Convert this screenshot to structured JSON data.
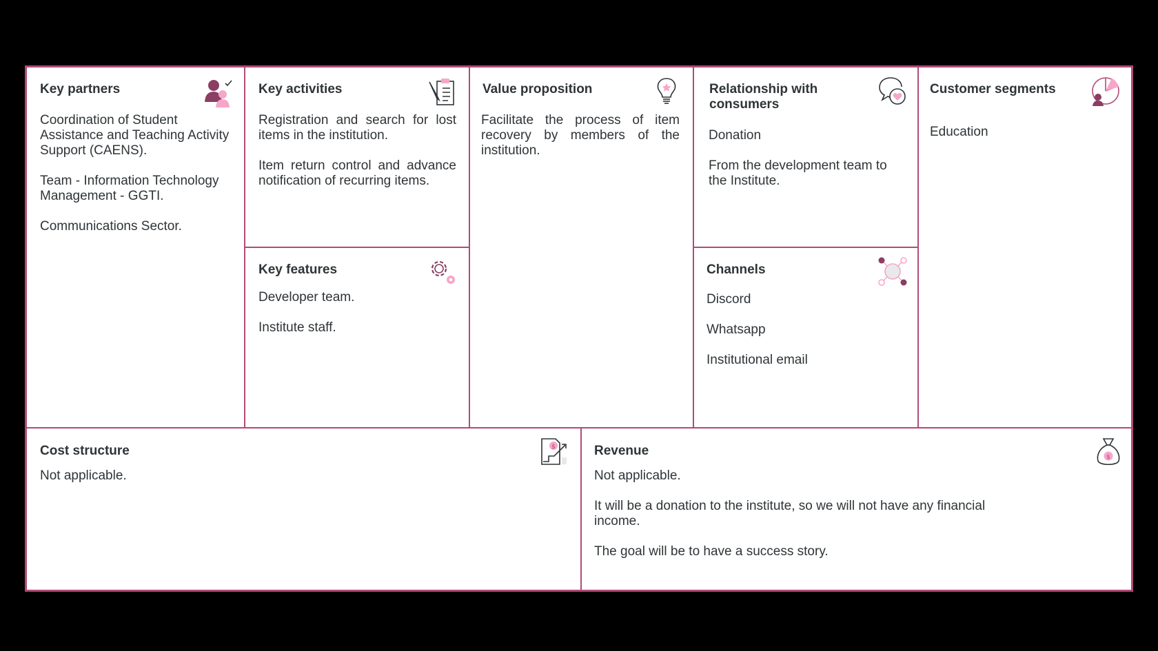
{
  "canvas": {
    "key_partners": {
      "title": "Key partners",
      "items": [
        "Coordination of Student Assistance and Teaching Activity Support (CAENS).",
        "Team - Information Technology Management - GGTI.",
        "Communications Sector."
      ],
      "icon": "partners-icon"
    },
    "key_activities": {
      "title": "Key activities",
      "items": [
        "Registration and search for lost items in the institution.",
        "Item return control and advance notification of recurring items."
      ],
      "icon": "clipboard-icon"
    },
    "key_features": {
      "title": "Key features",
      "items": [
        "Developer team.",
        "Institute staff."
      ],
      "icon": "gears-icon"
    },
    "value_proposition": {
      "title": "Value proposition",
      "items": [
        "Facilitate the process of item recovery by members of the institution."
      ],
      "icon": "lightbulb-icon"
    },
    "relationship": {
      "title": "Relationship with consumers",
      "items": [
        "Donation",
        "From the development team to the Institute."
      ],
      "icon": "chat-heart-icon"
    },
    "channels": {
      "title": "Channels",
      "items": [
        "Discord",
        "Whatsapp",
        "Institutional email"
      ],
      "icon": "network-icon"
    },
    "customer_segments": {
      "title": "Customer segments",
      "items": [
        "Education"
      ],
      "icon": "pie-user-icon"
    },
    "cost_structure": {
      "title": "Cost structure",
      "items": [
        "Not applicable."
      ],
      "icon": "cost-chart-icon"
    },
    "revenue": {
      "title": "Revenue",
      "items": [
        "Not applicable.",
        "It will be a donation to the institute, so we will not have any financial income.",
        "The goal will be to have a success story."
      ],
      "icon": "money-bag-icon"
    }
  },
  "colors": {
    "accent": "#b14a78",
    "pink": "#f6a6c8",
    "dark": "#8a3e63",
    "text": "#2f3437"
  }
}
